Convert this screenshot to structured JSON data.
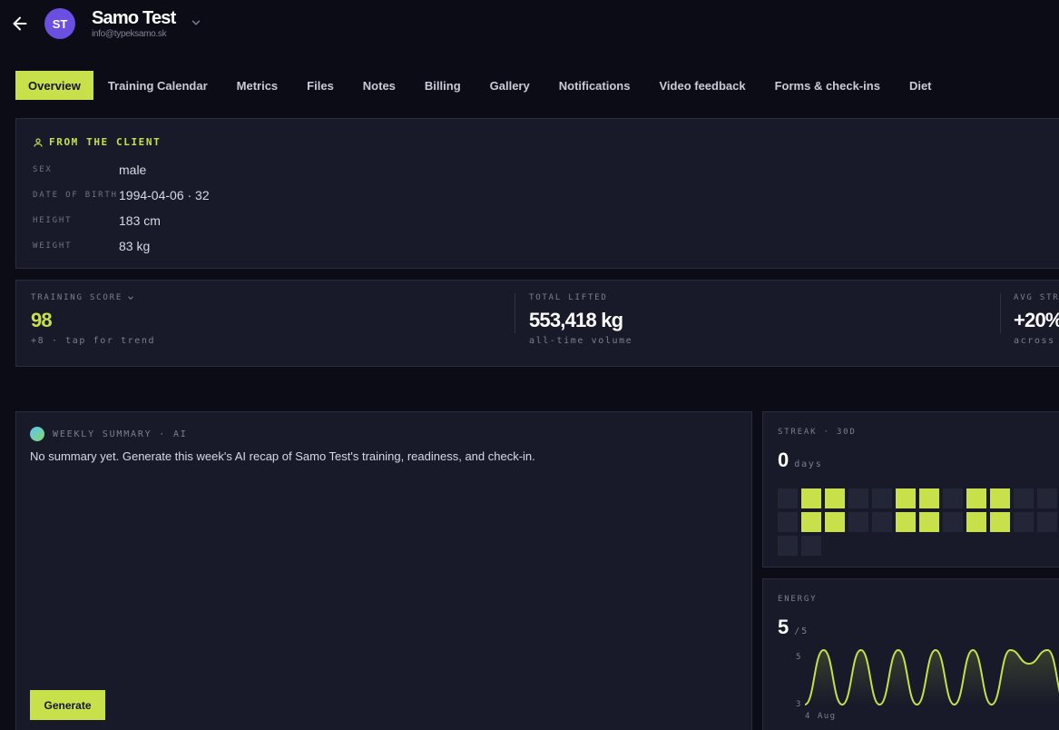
{
  "header": {
    "avatar_initials": "ST",
    "client_name": "Samo Test",
    "client_email": "info@typeksamo.sk"
  },
  "tabs": [
    {
      "label": "Overview",
      "active": true
    },
    {
      "label": "Training Calendar",
      "active": false
    },
    {
      "label": "Metrics",
      "active": false
    },
    {
      "label": "Files",
      "active": false
    },
    {
      "label": "Notes",
      "active": false
    },
    {
      "label": "Billing",
      "active": false
    },
    {
      "label": "Gallery",
      "active": false
    },
    {
      "label": "Notifications",
      "active": false
    },
    {
      "label": "Video feedback",
      "active": false
    },
    {
      "label": "Forms & check-ins",
      "active": false
    },
    {
      "label": "Diet",
      "active": false
    }
  ],
  "client_info": {
    "title": "FROM THE CLIENT",
    "fields": [
      {
        "label": "SEX",
        "value": "male"
      },
      {
        "label": "DATE OF BIRTH",
        "value": "1994-04-06 · 32"
      },
      {
        "label": "HEIGHT",
        "value": "183 cm"
      },
      {
        "label": "WEIGHT",
        "value": "83 kg"
      }
    ]
  },
  "stats": {
    "training_score": {
      "label": "TRAINING SCORE",
      "value": "98",
      "sub": "+8 · tap for trend"
    },
    "total_lifted": {
      "label": "TOTAL LIFTED",
      "value": "553,418 kg",
      "sub": "all-time volume"
    },
    "avg_strength": {
      "label": "AVG STRE",
      "value": "+20%",
      "sub": "across"
    }
  },
  "weekly_summary": {
    "label": "WEEKLY SUMMARY · AI",
    "text": "No summary yet. Generate this week's AI recap of Samo Test's training, readiness, and check-in.",
    "button_label": "Generate"
  },
  "streak": {
    "label": "STREAK · 30D",
    "value": "0",
    "unit": "days",
    "days": [
      0,
      1,
      1,
      0,
      0,
      1,
      1,
      0,
      1,
      1,
      0,
      0,
      0,
      1,
      1,
      0,
      0,
      1,
      1,
      0,
      1,
      1,
      0,
      0,
      0,
      0
    ]
  },
  "energy": {
    "label": "ENERGY",
    "value": "5",
    "max": "/5",
    "y_ticks": [
      "5",
      "3"
    ],
    "x_label": "4 Aug",
    "colors": {
      "line": "#c8e04a"
    }
  },
  "chart_data": {
    "type": "line",
    "series": [
      {
        "values": [
          3,
          5,
          3,
          5,
          3,
          5,
          3,
          5,
          3,
          5,
          3,
          5,
          4.5,
          5,
          3
        ]
      }
    ],
    "ylim": [
      3,
      5
    ]
  }
}
